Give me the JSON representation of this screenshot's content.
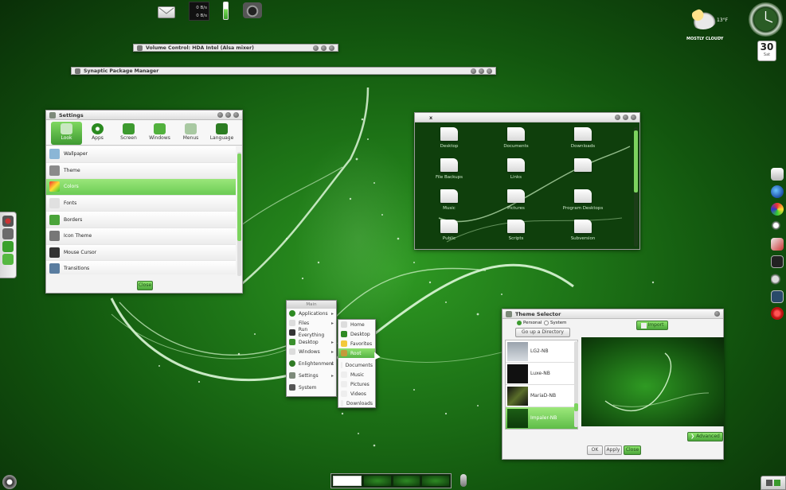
{
  "colors": {
    "accent": "#6fd14e",
    "accent_dark": "#3b9b30",
    "desktop": "#1b6e16"
  },
  "top_bar": {
    "mail_icon": "envelope-icon",
    "net_up": "0 B/s",
    "net_down": "0 B/s",
    "battery_icon": "battery-icon",
    "camera_icon": "camera-icon"
  },
  "weather": {
    "temp": "13°F",
    "label": "MOSTLY CLOUDY",
    "icon": "cloud-icon"
  },
  "clock": {
    "icon": "clock-icon"
  },
  "calendar": {
    "day": "30",
    "weekday": "Sat"
  },
  "windows": {
    "volume_title": "Volume Control: HDA Intel (Alsa mixer)",
    "synaptic_title": "Synaptic Package Manager",
    "files_title": "x"
  },
  "settings": {
    "title": "Settings",
    "tabs": [
      {
        "label": "Look"
      },
      {
        "label": "Apps"
      },
      {
        "label": "Screen"
      },
      {
        "label": "Windows"
      },
      {
        "label": "Menus"
      },
      {
        "label": "Language"
      }
    ],
    "items": [
      {
        "label": "Wallpaper"
      },
      {
        "label": "Theme"
      },
      {
        "label": "Colors"
      },
      {
        "label": "Fonts"
      },
      {
        "label": "Borders"
      },
      {
        "label": "Icon Theme"
      },
      {
        "label": "Mouse Cursor"
      },
      {
        "label": "Transitions"
      }
    ],
    "close_label": "Close"
  },
  "files": {
    "items": [
      {
        "label": "Desktop"
      },
      {
        "label": "Documents"
      },
      {
        "label": "Downloads"
      },
      {
        "label": "File Backups"
      },
      {
        "label": "Links"
      },
      {
        "label": "Music"
      },
      {
        "label": "Pictures"
      },
      {
        "label": "Program Desktops"
      },
      {
        "label": "Public"
      },
      {
        "label": "Scripts"
      },
      {
        "label": "Subversion"
      }
    ]
  },
  "main_menu": {
    "title": "Main",
    "items": [
      {
        "label": "Applications"
      },
      {
        "label": "Files"
      },
      {
        "label": "Run Everything"
      },
      {
        "label": "Desktop"
      },
      {
        "label": "Windows"
      },
      {
        "label": "Enlightenment"
      },
      {
        "label": "Settings"
      },
      {
        "label": "System"
      }
    ],
    "sub": [
      {
        "label": "Home"
      },
      {
        "label": "Desktop"
      },
      {
        "label": "Favorites"
      },
      {
        "label": "Root"
      },
      {
        "label": "Documents"
      },
      {
        "label": "Music"
      },
      {
        "label": "Pictures"
      },
      {
        "label": "Videos"
      },
      {
        "label": "Downloads"
      }
    ]
  },
  "theme_selector": {
    "title": "Theme Selector",
    "radio_personal": "Personal",
    "radio_system": "System",
    "go_up": "Go up a Directory",
    "import_label": "Import",
    "themes": [
      {
        "label": "LG2-NB"
      },
      {
        "label": "Luxe-NB"
      },
      {
        "label": "MariaD-NB"
      },
      {
        "label": "Impaler-NB"
      }
    ],
    "advanced_label": "Advanced",
    "ok_label": "OK",
    "apply_label": "Apply",
    "close_label": "Close"
  }
}
